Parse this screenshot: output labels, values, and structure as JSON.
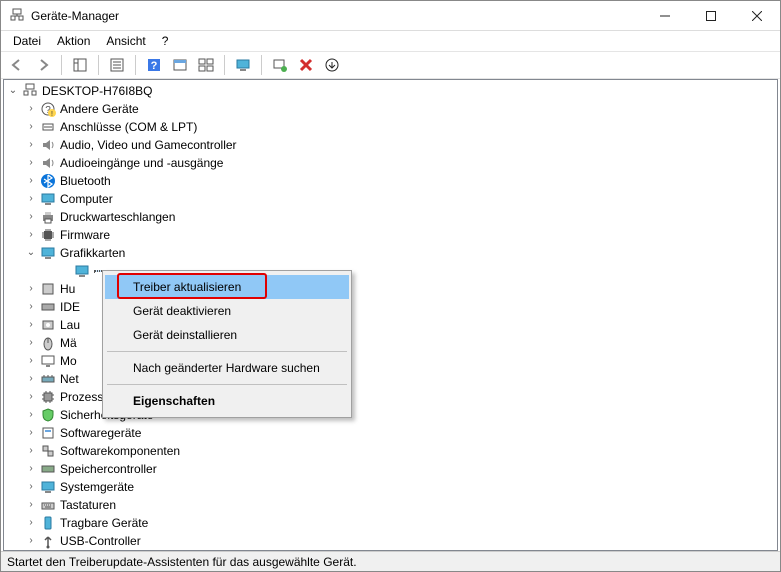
{
  "window": {
    "title": "Geräte-Manager"
  },
  "menubar": {
    "items": [
      "Datei",
      "Aktion",
      "Ansicht",
      "?"
    ]
  },
  "toolbar": {
    "back": "back-icon",
    "forward": "forward-icon",
    "showhide": "showhide-icon",
    "properties": "properties-icon",
    "categories": "categories-icon",
    "help": "help-icon",
    "subwin": "subwin-icon",
    "monitor": "monitor-icon",
    "scan": "scan-icon",
    "uninstall": "uninstall-icon",
    "updown": "updown-icon"
  },
  "tree": {
    "root": {
      "label": "DESKTOP-H76I8BQ",
      "expanded": true
    },
    "categories": [
      {
        "label": "Andere Geräte",
        "icon": "question-warn",
        "expanded": false,
        "expandable": true
      },
      {
        "label": "Anschlüsse (COM & LPT)",
        "icon": "port",
        "expanded": false,
        "expandable": true
      },
      {
        "label": "Audio, Video und Gamecontroller",
        "icon": "speaker",
        "expanded": false,
        "expandable": true
      },
      {
        "label": "Audioeingänge und -ausgänge",
        "icon": "speaker",
        "expanded": false,
        "expandable": true
      },
      {
        "label": "Bluetooth",
        "icon": "bluetooth",
        "expanded": false,
        "expandable": true
      },
      {
        "label": "Computer",
        "icon": "monitor",
        "expanded": false,
        "expandable": true
      },
      {
        "label": "Druckwarteschlangen",
        "icon": "printer",
        "expanded": false,
        "expandable": true
      },
      {
        "label": "Firmware",
        "icon": "chip",
        "expanded": false,
        "expandable": true
      },
      {
        "label": "Grafikkarten",
        "icon": "display",
        "expanded": true,
        "expandable": true,
        "children": [
          {
            "label": "",
            "icon": "display",
            "selected": true
          }
        ]
      },
      {
        "label": "Hu",
        "icon": "hid",
        "expanded": false,
        "expandable": true
      },
      {
        "label": "IDE",
        "icon": "storage",
        "expanded": false,
        "expandable": true
      },
      {
        "label": "Lau",
        "icon": "disk",
        "expanded": false,
        "expandable": true
      },
      {
        "label": "Mä",
        "icon": "mouse",
        "expanded": false,
        "expandable": true
      },
      {
        "label": "Mo",
        "icon": "monitor2",
        "expanded": false,
        "expandable": true
      },
      {
        "label": "Net",
        "icon": "network",
        "expanded": false,
        "expandable": true
      },
      {
        "label": "Prozessoren",
        "icon": "cpu",
        "expanded": false,
        "expandable": true
      },
      {
        "label": "Sicherheitsgeräte",
        "icon": "security",
        "expanded": false,
        "expandable": true
      },
      {
        "label": "Softwaregeräte",
        "icon": "software",
        "expanded": false,
        "expandable": true
      },
      {
        "label": "Softwarekomponenten",
        "icon": "component",
        "expanded": false,
        "expandable": true
      },
      {
        "label": "Speichercontroller",
        "icon": "storagectl",
        "expanded": false,
        "expandable": true
      },
      {
        "label": "Systemgeräte",
        "icon": "system",
        "expanded": false,
        "expandable": true
      },
      {
        "label": "Tastaturen",
        "icon": "keyboard",
        "expanded": false,
        "expandable": true
      },
      {
        "label": "Tragbare Geräte",
        "icon": "portable",
        "expanded": false,
        "expandable": true
      },
      {
        "label": "USB-Controller",
        "icon": "usb",
        "expanded": false,
        "expandable": true
      }
    ]
  },
  "contextmenu": {
    "items": [
      {
        "label": "Treiber aktualisieren",
        "highlight": true
      },
      {
        "label": "Gerät deaktivieren"
      },
      {
        "label": "Gerät deinstallieren"
      },
      {
        "sep": true
      },
      {
        "label": "Nach geänderter Hardware suchen"
      },
      {
        "sep": true
      },
      {
        "label": "Eigenschaften",
        "bold": true
      }
    ]
  },
  "statusbar": {
    "text": "Startet den Treiberupdate-Assistenten für das ausgewählte Gerät."
  },
  "colors": {
    "selection": "#cce8ff",
    "ctx_highlight": "#90c8f6",
    "red_box": "#e00000"
  }
}
